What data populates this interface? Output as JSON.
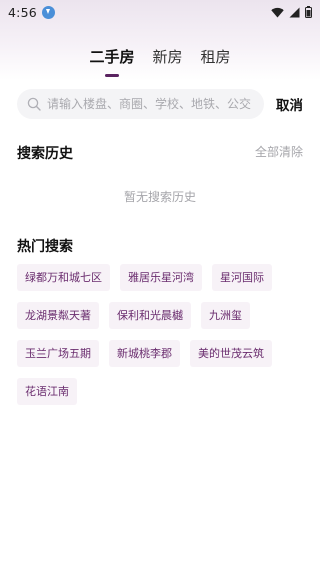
{
  "status_bar": {
    "time": "4:56",
    "icons": [
      "download-icon",
      "wifi-icon",
      "signal-icon",
      "battery-icon"
    ]
  },
  "tabs": [
    {
      "label": "二手房",
      "active": true
    },
    {
      "label": "新房",
      "active": false
    },
    {
      "label": "租房",
      "active": false
    }
  ],
  "search": {
    "icon": "search-icon",
    "placeholder": "请输入楼盘、商圈、学校、地铁、公交",
    "value": "",
    "cancel_label": "取消"
  },
  "history": {
    "title": "搜索历史",
    "clear_label": "全部清除",
    "empty_text": "暂无搜索历史"
  },
  "hot": {
    "title": "热门搜索",
    "rows": [
      [
        "绿都万和城七区",
        "雅居乐星河湾",
        "星河国际"
      ],
      [
        "龙湖景粼天著",
        "保利和光晨樾",
        "九洲玺"
      ],
      [
        "玉兰广场五期",
        "新城桃李郡",
        "美的世茂云筑"
      ],
      [
        "花语江南"
      ]
    ]
  },
  "colors": {
    "accent": "#5a2360",
    "tag_bg": "#f7f2f7",
    "tag_text": "#6a2c6e",
    "muted": "#a5a5aa"
  }
}
